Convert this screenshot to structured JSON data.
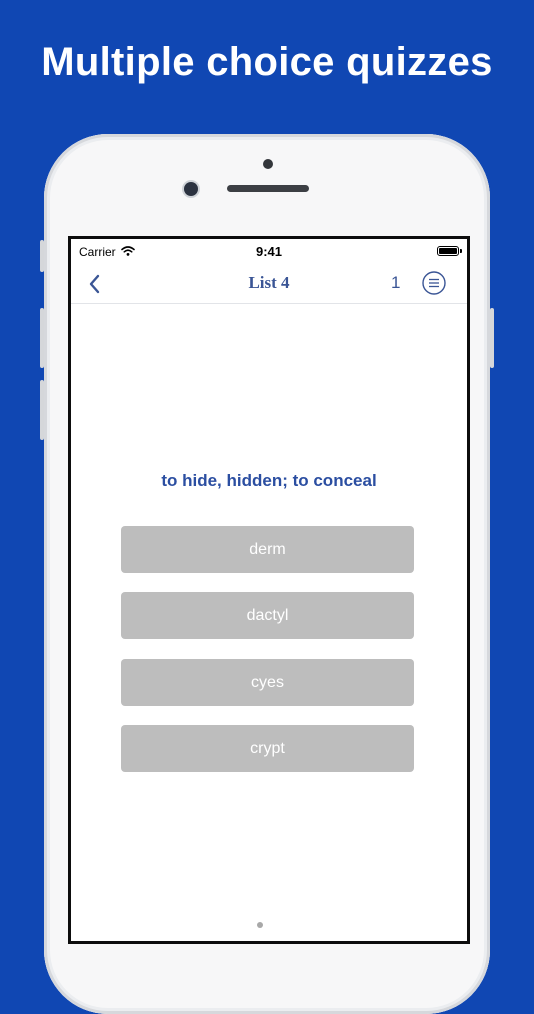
{
  "headline": "Multiple choice quizzes",
  "status_bar": {
    "carrier": "Carrier",
    "time": "9:41"
  },
  "nav": {
    "title": "List 4",
    "count": "1"
  },
  "quiz": {
    "prompt": "to hide, hidden; to conceal",
    "choices": [
      "derm",
      "dactyl",
      "cyes",
      "crypt"
    ]
  },
  "colors": {
    "background": "#1047b3",
    "accent": "#3a5595",
    "prompt": "#2b4ea1",
    "choice_bg": "#bdbdbd"
  },
  "icons": {
    "back": "chevron-left-icon",
    "menu": "list-circle-icon",
    "wifi": "wifi-icon",
    "battery": "battery-icon"
  }
}
